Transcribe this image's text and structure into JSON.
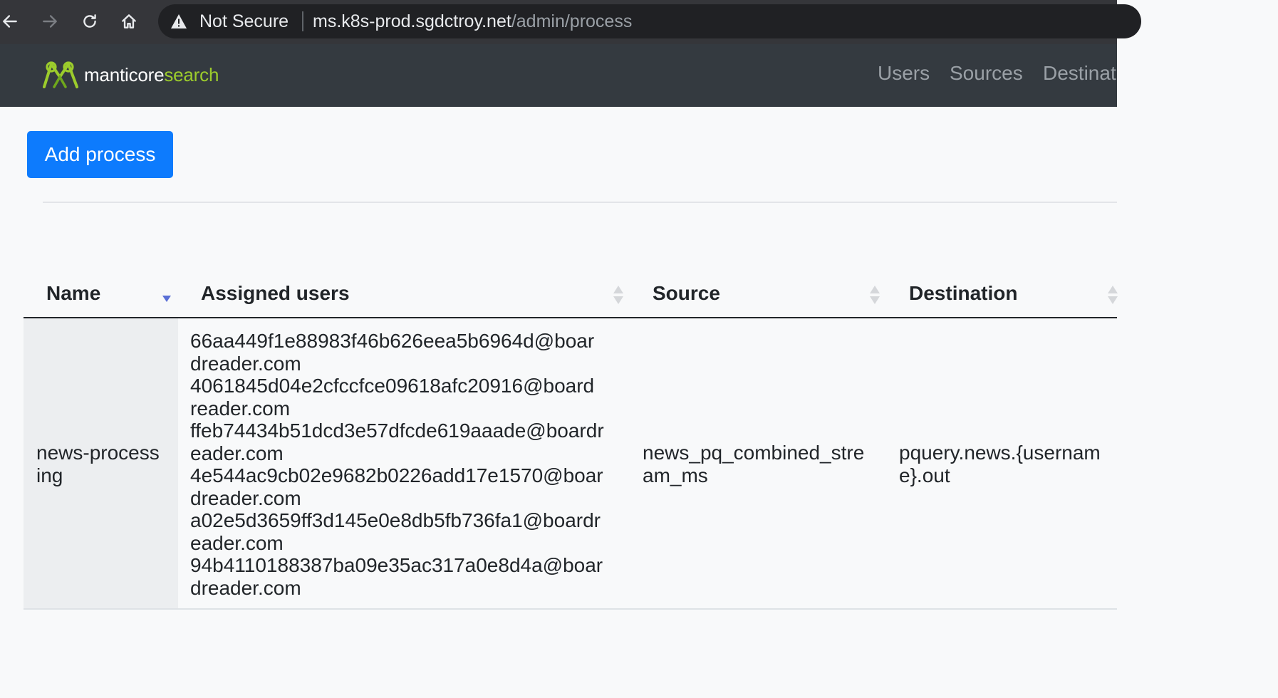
{
  "browser": {
    "security_label": "Not Secure",
    "url_host": "ms.k8s-prod.sgdctroy.net",
    "url_path": "/admin/process"
  },
  "navbar": {
    "logo_part1": "manticore",
    "logo_part2": "search",
    "links": [
      "Users",
      "Sources",
      "Destinat"
    ]
  },
  "page": {
    "add_button_label": "Add process"
  },
  "table": {
    "headers": [
      "Name",
      "Assigned users",
      "Source",
      "Destination"
    ],
    "rows": [
      {
        "name_lines": [
          "news-process",
          "ing"
        ],
        "users_lines": [
          "66aa449f1e88983f46b626eea5b6964d@boar",
          "dreader.com",
          "4061845d04e2cfccfce09618afc20916@board",
          "reader.com",
          "ffeb74434b51dcd3e57dfcde619aaade@boardr",
          "eader.com",
          "4e544ac9cb02e9682b0226add17e1570@boar",
          "dreader.com",
          "a02e5d3659ff3d145e0e8db5fb736fa1@boardr",
          "eader.com",
          "94b4110188387ba09e35ac317a0e8d4a@boar",
          "dreader.com"
        ],
        "source_lines": [
          "news_pq_combined_stre",
          "am_ms"
        ],
        "destination_lines": [
          "pquery.news.{usernam",
          "e}.out"
        ]
      }
    ]
  },
  "colors": {
    "accent": "#0d7bfd",
    "navbar_bg": "#343a40",
    "logo_green": "#9ccc2c",
    "sort_active": "#5a6fd6"
  }
}
